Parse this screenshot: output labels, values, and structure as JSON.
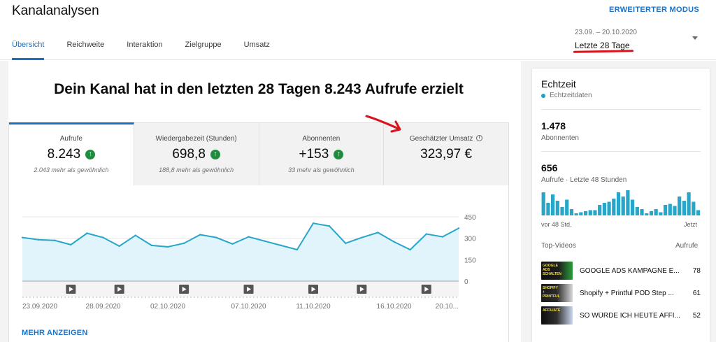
{
  "header": {
    "title": "Kanalanalysen",
    "advanced_mode": "ERWEITERTER MODUS",
    "tabs": [
      {
        "label": "Übersicht",
        "active": true
      },
      {
        "label": "Reichweite",
        "active": false
      },
      {
        "label": "Interaktion",
        "active": false
      },
      {
        "label": "Zielgruppe",
        "active": false
      },
      {
        "label": "Umsatz",
        "active": false
      }
    ],
    "date_range": "23.09. – 20.10.2020",
    "date_label": "Letzte 28 Tage"
  },
  "main": {
    "headline": "Dein Kanal hat in den letzten 28 Tagen 8.243 Aufrufe erzielt",
    "metrics": [
      {
        "label": "Aufrufe",
        "value": "8.243",
        "sub": "2.043 mehr als gewöhnlich",
        "trend": "up-icon"
      },
      {
        "label": "Wiedergabezeit (Stunden)",
        "value": "698,8",
        "sub": "188,8 mehr als gewöhnlich",
        "trend": "up-icon"
      },
      {
        "label": "Abonnenten",
        "value": "+153",
        "sub": "33 mehr als gewöhnlich",
        "trend": "up-icon"
      },
      {
        "label": "Geschätzter Umsatz",
        "value": "323,97 €",
        "sub": "",
        "trend": "clock-icon"
      }
    ],
    "more_link": "MEHR ANZEIGEN"
  },
  "chart_data": {
    "type": "area",
    "x": [
      "23.09.2020",
      "24.09.2020",
      "25.09.2020",
      "26.09.2020",
      "27.09.2020",
      "28.09.2020",
      "29.09.2020",
      "30.09.2020",
      "01.10.2020",
      "02.10.2020",
      "03.10.2020",
      "04.10.2020",
      "05.10.2020",
      "06.10.2020",
      "07.10.2020",
      "08.10.2020",
      "09.10.2020",
      "10.10.2020",
      "11.10.2020",
      "12.10.2020",
      "13.10.2020",
      "14.10.2020",
      "15.10.2020",
      "16.10.2020",
      "17.10.2020",
      "18.10.2020",
      "19.10.2020",
      "20.10.2020"
    ],
    "values": [
      305,
      290,
      285,
      255,
      335,
      305,
      245,
      320,
      250,
      240,
      265,
      325,
      305,
      260,
      310,
      280,
      250,
      220,
      405,
      385,
      265,
      305,
      340,
      275,
      220,
      330,
      310,
      370
    ],
    "xticks": [
      "23.09.2020",
      "28.09.2020",
      "02.10.2020",
      "07.10.2020",
      "11.10.2020",
      "16.10.2020",
      "20.10..."
    ],
    "yticks": [
      "450",
      "300",
      "150",
      "0"
    ],
    "ylim": [
      0,
      450
    ],
    "video_markers_at": [
      "26.09.2020",
      "29.09.2020",
      "03.10.2020",
      "07.10.2020",
      "11.10.2020",
      "14.10.2020",
      "18.10.2020"
    ],
    "color": "#27a6c9",
    "fill": "#e2f4fb"
  },
  "realtime": {
    "title": "Echtzeit",
    "live_label": "Echtzeitdaten",
    "subscribers_value": "1.478",
    "subscribers_label": "Abonnenten",
    "views_value": "656",
    "views_label": "Aufrufe · Letzte 48 Stunden",
    "axis_start": "vor 48 Std.",
    "axis_end": "Jetzt",
    "bars": [
      22,
      12,
      20,
      14,
      8,
      15,
      6,
      2,
      3,
      4,
      5,
      5,
      10,
      12,
      13,
      16,
      22,
      18,
      24,
      15,
      8,
      6,
      2,
      4,
      6,
      3,
      10,
      11,
      9,
      18,
      14,
      22,
      13,
      5
    ],
    "bar_color": "#27a6c9",
    "top_videos_label": "Top-Videos",
    "views_col_label": "Aufrufe",
    "videos": [
      {
        "title": "GOOGLE ADS KAMPAGNE E...",
        "views": "78",
        "thumb_text": "GOOGLE ADS SCHALTEN"
      },
      {
        "title": "Shopify + Printful POD Step ...",
        "views": "61",
        "thumb_text": "SHOPIFY + PRINTFUL"
      },
      {
        "title": "SO WÜRDE ICH HEUTE AFFI...",
        "views": "52",
        "thumb_text": "AFFILIATE"
      }
    ]
  }
}
